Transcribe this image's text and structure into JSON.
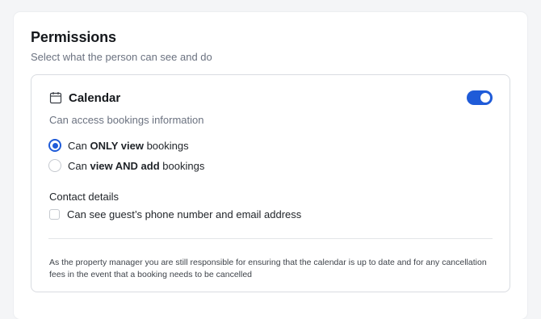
{
  "panel": {
    "title": "Permissions",
    "subtitle": "Select what the person can see and do"
  },
  "card": {
    "icon": "calendar-icon",
    "title": "Calendar",
    "toggle": {
      "on": true,
      "color": "#1f5bd8"
    },
    "description": "Can access bookings information",
    "options": [
      {
        "prefix": "Can ",
        "bold": "ONLY view",
        "suffix": " bookings",
        "checked": true
      },
      {
        "prefix": "Can ",
        "bold": "view AND add",
        "suffix": " bookings",
        "checked": false
      }
    ],
    "contact": {
      "label": "Contact details",
      "checkbox_label": "Can see guest’s phone number and email address",
      "checked": false
    },
    "notice": "As the property manager you are still responsible for ensuring that the calendar is up to date and for any cancellation fees in the event that a booking needs to be cancelled"
  },
  "colors": {
    "accent": "#1f5bd8"
  }
}
